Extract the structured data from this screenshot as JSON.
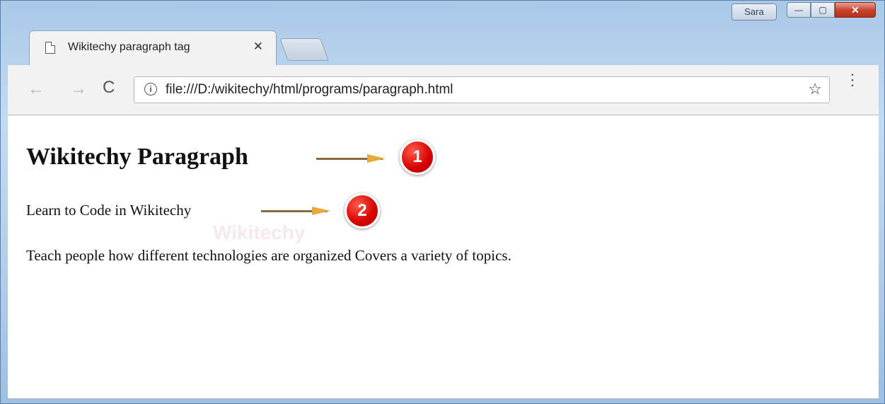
{
  "window": {
    "user_label": "Sara",
    "min_glyph": "—",
    "max_glyph": "▢",
    "close_glyph": "✕"
  },
  "tab": {
    "title": "Wikitechy paragraph tag",
    "close_glyph": "✕",
    "icon": "page-icon"
  },
  "toolbar": {
    "back_glyph": "←",
    "forward_glyph": "→",
    "reload_glyph": "C",
    "info_glyph": "i",
    "url": "file:///D:/wikitechy/html/programs/paragraph.html",
    "star_glyph": "☆",
    "menu_glyph": "⋮"
  },
  "page": {
    "heading": "Wikitechy Paragraph",
    "paragraph1": "Learn to Code in Wikitechy",
    "paragraph2": "Teach people how different technologies are organized Covers a variety of topics.",
    "watermark": "Wikitechy"
  },
  "annotations": {
    "badge1": "1",
    "badge2": "2",
    "colors": {
      "badge": "#d40000",
      "arrow": "#e8a93a"
    }
  }
}
